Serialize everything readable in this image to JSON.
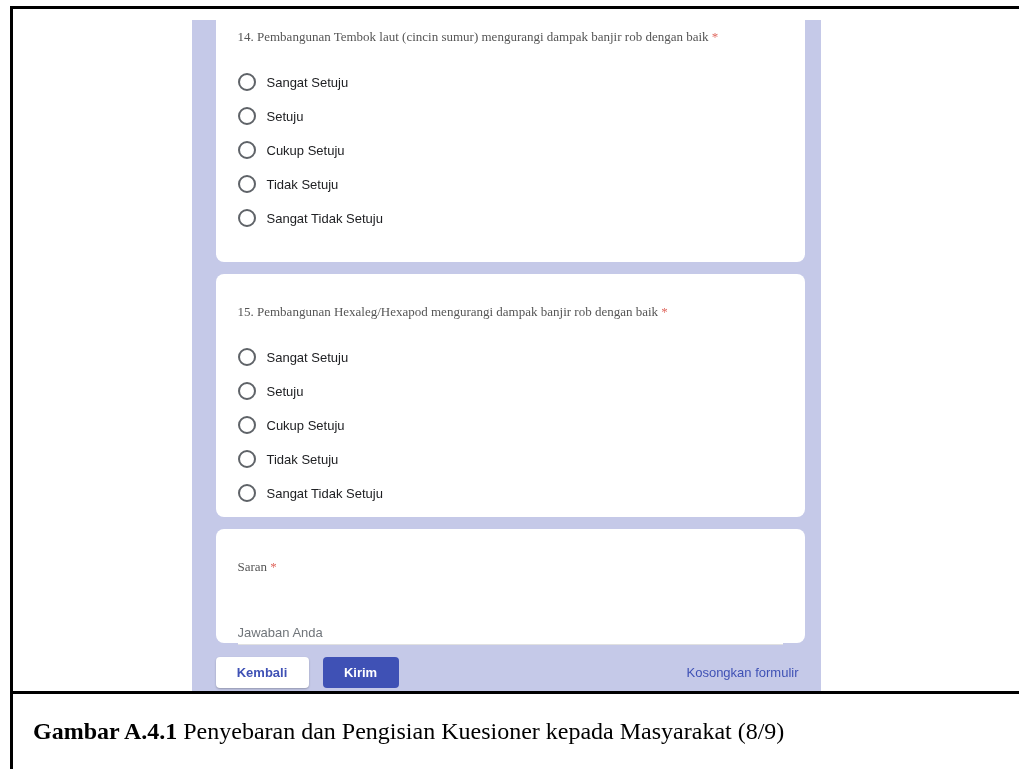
{
  "questions": [
    {
      "title": "14. Pembangunan Tembok laut (cincin sumur) mengurangi dampak banjir rob dengan baik",
      "required_mark": "*",
      "options": [
        {
          "label": "Sangat Setuju",
          "selected": false
        },
        {
          "label": "Setuju",
          "selected": false
        },
        {
          "label": "Cukup Setuju",
          "selected": false
        },
        {
          "label": "Tidak Setuju",
          "selected": false
        },
        {
          "label": "Sangat Tidak Setuju",
          "selected": false
        }
      ]
    },
    {
      "title": "15. Pembangunan Hexaleg/Hexapod mengurangi dampak banjir rob dengan baik",
      "required_mark": "*",
      "options": [
        {
          "label": "Sangat Setuju",
          "selected": false
        },
        {
          "label": "Setuju",
          "selected": false
        },
        {
          "label": "Cukup Setuju",
          "selected": false
        },
        {
          "label": "Tidak Setuju",
          "selected": false
        },
        {
          "label": "Sangat Tidak Setuju",
          "selected": false
        }
      ]
    }
  ],
  "text_question": {
    "title": "Saran",
    "required_mark": "*",
    "placeholder": "Jawaban Anda"
  },
  "buttons": [
    {
      "label": "Kembali",
      "kind": "secondary"
    },
    {
      "label": "Kirim",
      "kind": "primary"
    }
  ],
  "clear_link": "Kosongkan formulir",
  "caption": "**Gambar A.4.1** Penyebaran dan Pengisian Kuesioner kepada Masyarakat (8/9)"
}
